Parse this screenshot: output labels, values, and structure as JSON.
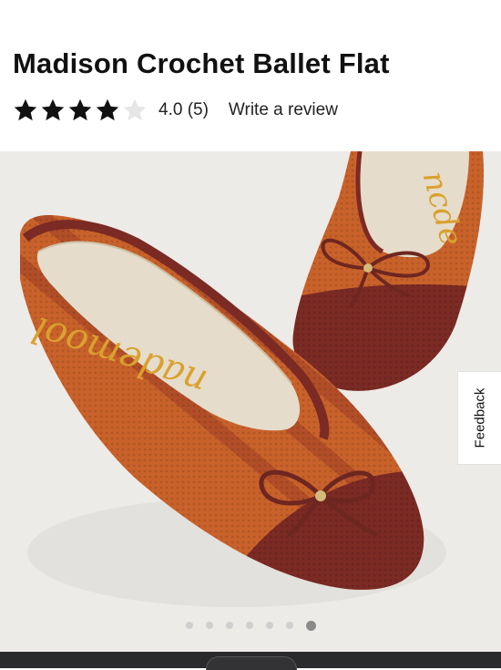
{
  "product": {
    "title": "Madison Crochet Ballet Flat",
    "rating_value": 4,
    "rating_max": 5,
    "rating_text": "4.0 (5)",
    "review_link": "Write a review"
  },
  "gallery": {
    "image_subject": "crochet-ballet-flats-pair",
    "insole_brand_text": "Sam Edelman",
    "slide_count": 7,
    "active_slide": 7
  },
  "feedback_tab": {
    "label": "Feedback"
  },
  "colors": {
    "star_filled": "#111111",
    "star_empty": "#e6e6e6",
    "rust": "#c9622a",
    "burgundy": "#7b2a24",
    "insole": "#e6dccb",
    "logo_gold": "#d9a12e"
  }
}
